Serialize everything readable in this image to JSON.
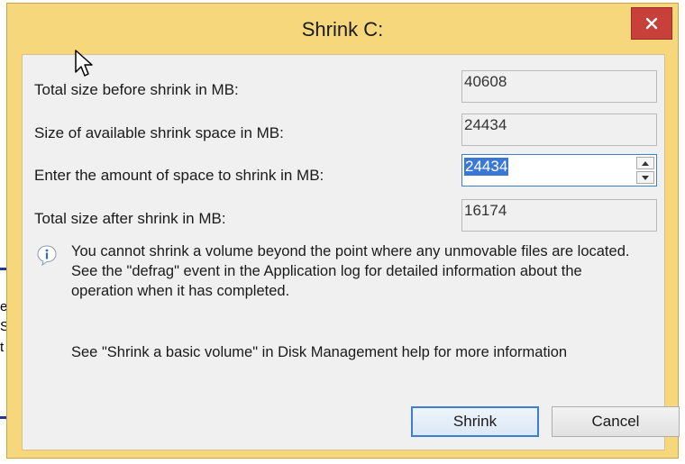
{
  "background": {
    "glyphs": [
      "e",
      "S",
      "t"
    ]
  },
  "dialog": {
    "title": "Shrink C:",
    "close_icon": "close-icon",
    "fields": {
      "before_label": "Total size before shrink in MB:",
      "before_value": "40608",
      "available_label": "Size of available shrink space in MB:",
      "available_value": "24434",
      "amount_label": "Enter the amount of space to shrink in MB:",
      "amount_value": "24434",
      "after_label": "Total size after shrink in MB:",
      "after_value": "16174"
    },
    "info": {
      "icon": "info-icon",
      "lines": [
        "You cannot shrink a volume beyond the point where any unmovable files are located.",
        "See the \"defrag\" event in the Application log for detailed information about the",
        "operation when it has completed."
      ]
    },
    "help_text": "See \"Shrink a basic volume\" in Disk Management help for more information",
    "buttons": {
      "shrink": "Shrink",
      "cancel": "Cancel"
    }
  },
  "colors": {
    "titlebar": "#f6d77b",
    "close": "#c7403a",
    "selection": "#3b78d6"
  }
}
